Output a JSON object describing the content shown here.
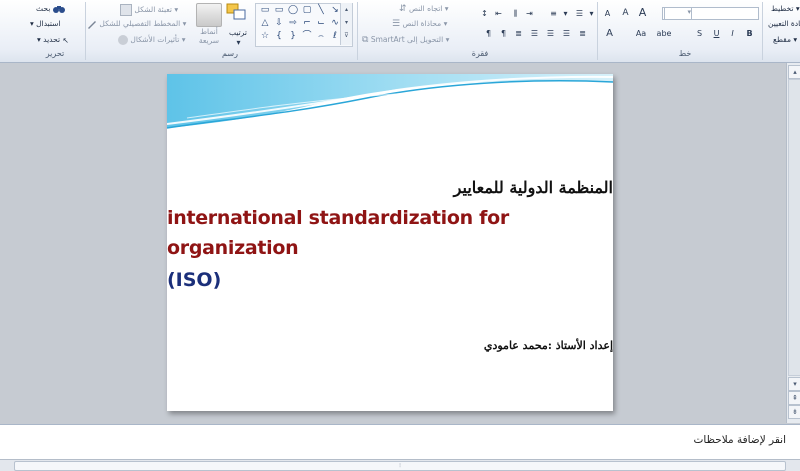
{
  "ribbon": {
    "groups": {
      "editing": "تحرير",
      "drawing": "رسم",
      "paragraph": "فقرة",
      "font": "خط"
    },
    "editing": {
      "find": "بحث",
      "replace": "استبدال",
      "select": "تحديد"
    },
    "drawing": {
      "arrange": "ترتيب",
      "quick_styles": "أنماط سريعة",
      "shape_fill": "تعبئة الشكل",
      "shape_outline": "المخطط التفصيلي للشكل",
      "shape_effects": "تأثيرات الأشكال"
    },
    "paragraph": {
      "text_direction": "اتجاه النص",
      "align_text": "محاذاة النص",
      "convert_smartart": "التحويل إلى SmartArt"
    },
    "font": {
      "bold": "B",
      "italic": "I",
      "underline": "U",
      "strike": "S",
      "shadow": "abe",
      "change_case": "Aa",
      "font_color": "A",
      "grow": "A",
      "shrink": "A",
      "clear": "A"
    },
    "slides": {
      "layout": "تخطيط",
      "reset": "إعادة التعيين",
      "section": "مقطع"
    }
  },
  "slide": {
    "title_ar": "المنظمة الدولية للمعايير",
    "title_en_line1": "international standardization for",
    "title_en_line2": "organization",
    "title_iso": "(ISO)",
    "author": "إعداد الأستاذ :محمد عامودي"
  },
  "notes": {
    "placeholder": "انقر لإضافة ملاحظات"
  },
  "colors": {
    "title_en": "#8f1414",
    "title_iso": "#1b2f7a",
    "wave_accent": "#3fb0dd"
  }
}
